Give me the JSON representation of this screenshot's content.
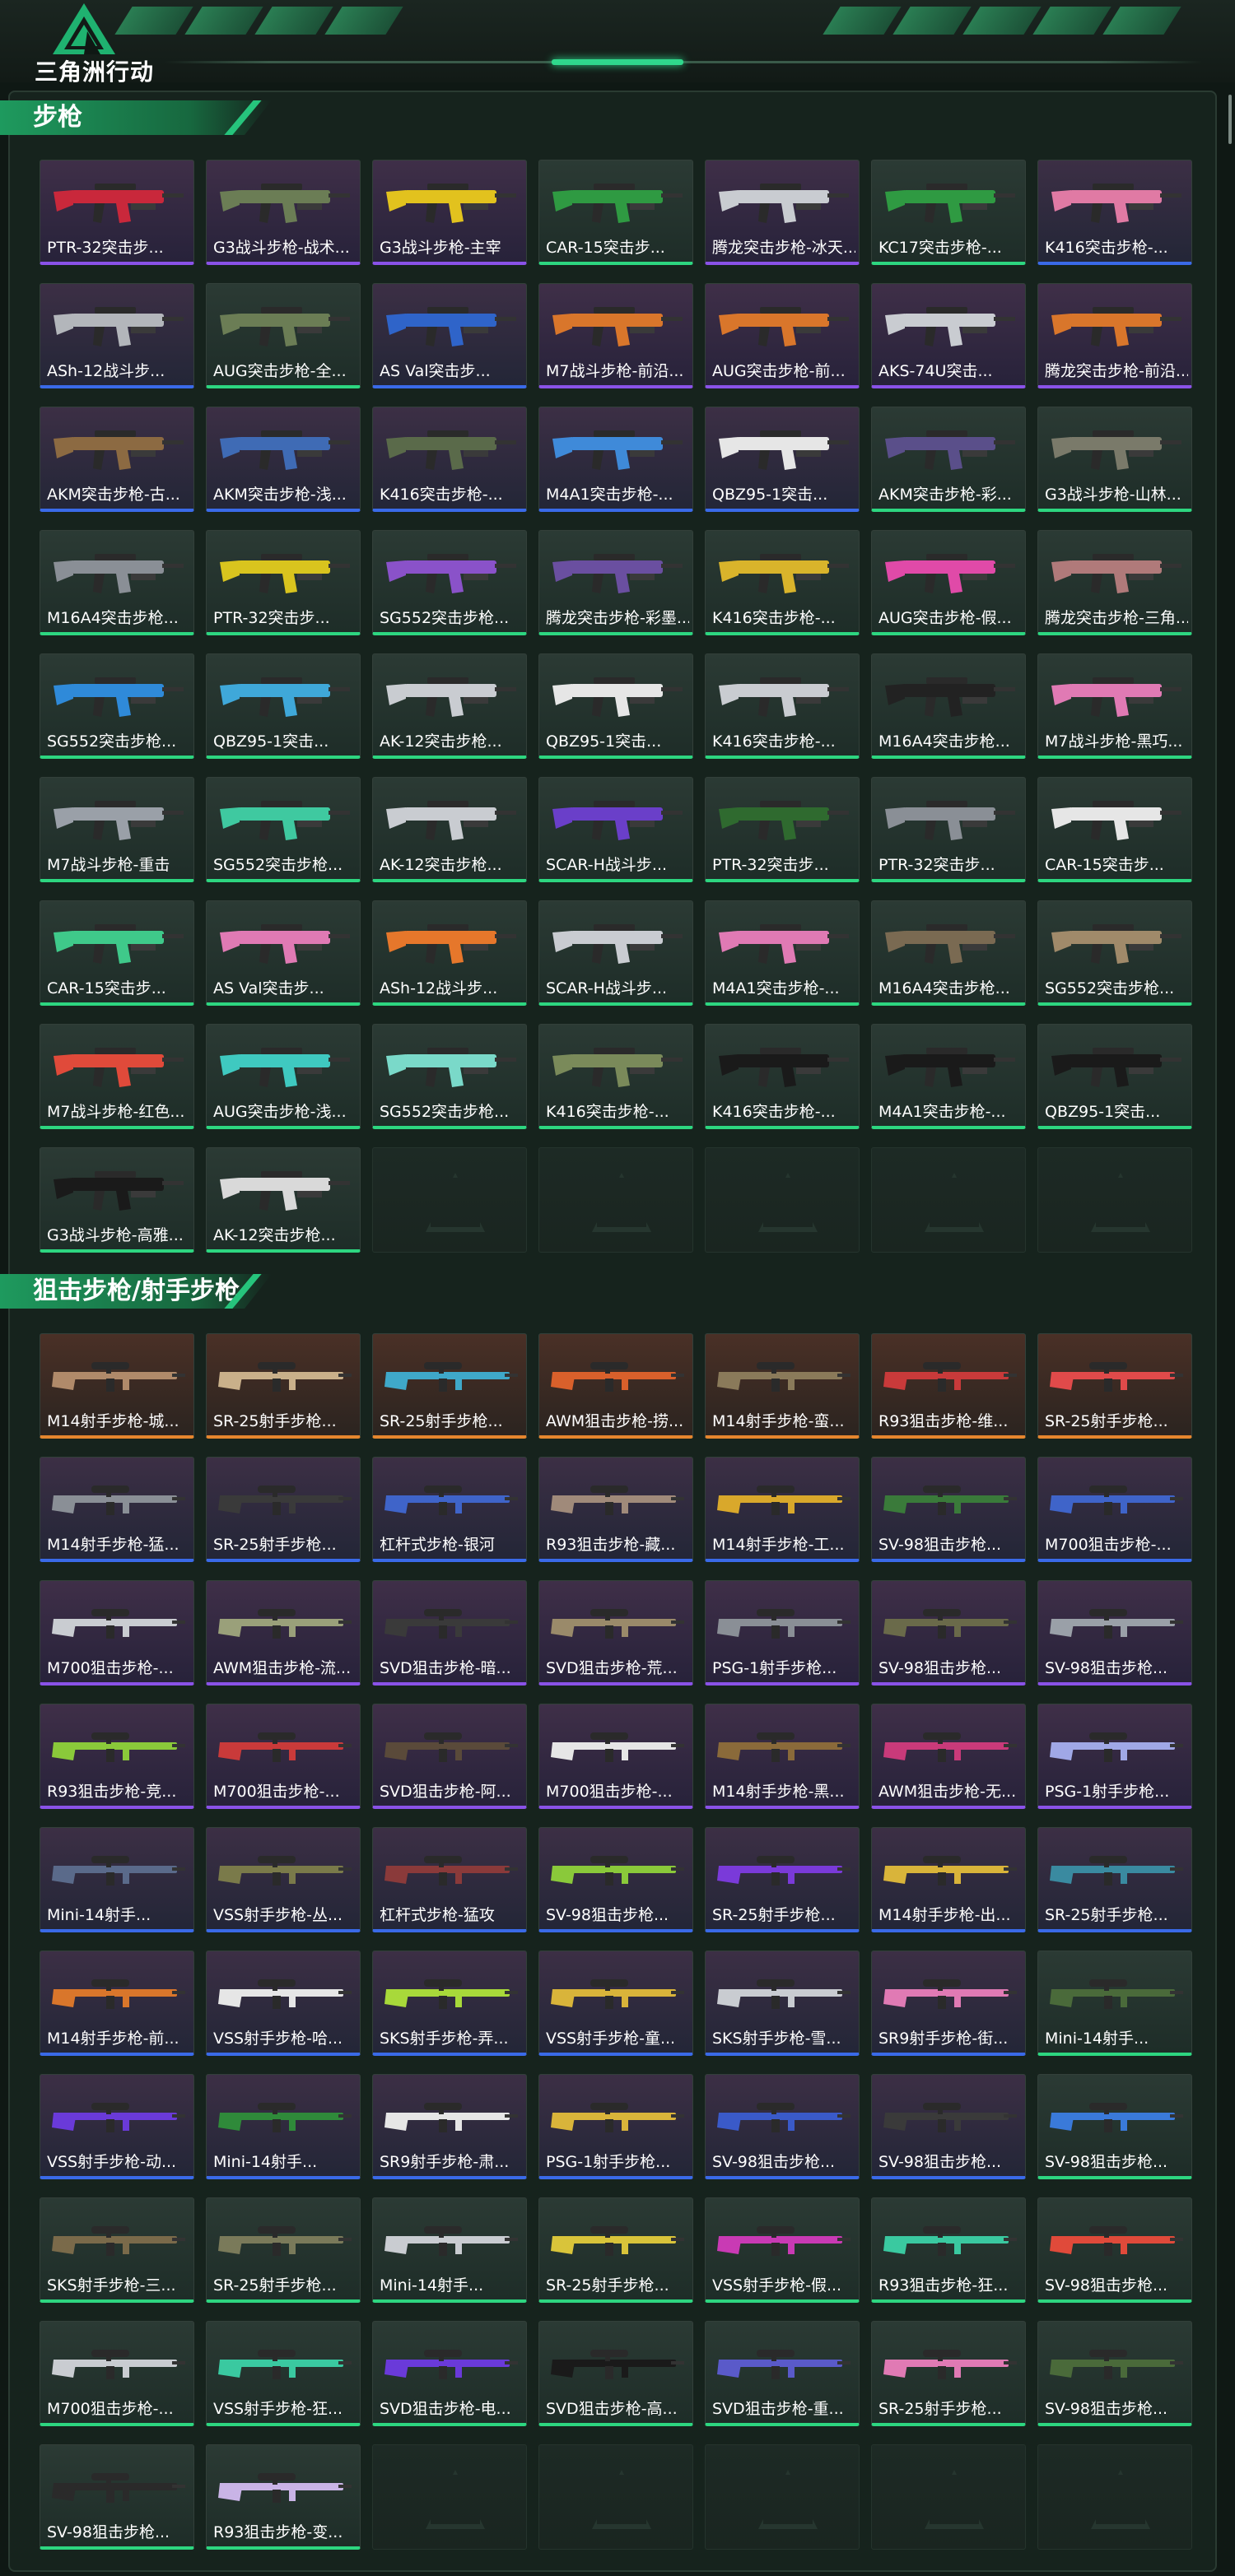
{
  "header": {
    "logo_text": "三角洲行动",
    "accent": "#2dd680"
  },
  "sections": [
    {
      "title": "步枪",
      "items": [
        {
          "label": "PTR-32突击步...",
          "rarity": "purple",
          "color": "#c9283b"
        },
        {
          "label": "G3战斗步枪-战术...",
          "rarity": "purple",
          "color": "#6b7d55"
        },
        {
          "label": "G3战斗步枪-主宰",
          "rarity": "purple",
          "color": "#e2c21e"
        },
        {
          "label": "CAR-15突击步...",
          "rarity": "green",
          "color": "#2f9a42"
        },
        {
          "label": "腾龙突击步枪-冰天...",
          "rarity": "purple",
          "color": "#c9ccd1"
        },
        {
          "label": "KC17突击步枪-...",
          "rarity": "green",
          "color": "#2f9a42"
        },
        {
          "label": "K416突击步枪-...",
          "rarity": "blue",
          "color": "#e07aa4"
        },
        {
          "label": "ASh-12战斗步...",
          "rarity": "blue",
          "color": "#b3b6bb"
        },
        {
          "label": "AUG突击步枪-全...",
          "rarity": "green",
          "color": "#6b7d55"
        },
        {
          "label": "AS Val突击步...",
          "rarity": "blue",
          "color": "#2f64c9"
        },
        {
          "label": "M7战斗步枪-前沿...",
          "rarity": "purple",
          "color": "#d9762b"
        },
        {
          "label": "AUG突击步枪-前...",
          "rarity": "purple",
          "color": "#d9762b"
        },
        {
          "label": "AKS-74U突击...",
          "rarity": "purple",
          "color": "#c9ccd1"
        },
        {
          "label": "腾龙突击步枪-前沿...",
          "rarity": "purple",
          "color": "#d9762b"
        },
        {
          "label": "AKM突击步枪-古...",
          "rarity": "blue",
          "color": "#8c6a42"
        },
        {
          "label": "AKM突击步枪-浅...",
          "rarity": "blue",
          "color": "#3f6bb5"
        },
        {
          "label": "K416突击步枪-...",
          "rarity": "blue",
          "color": "#5a6a4a"
        },
        {
          "label": "M4A1突击步枪-...",
          "rarity": "blue",
          "color": "#3f8ad9"
        },
        {
          "label": "QBZ95-1突击...",
          "rarity": "blue",
          "color": "#e6e6e6"
        },
        {
          "label": "AKM突击步枪-彩...",
          "rarity": "green",
          "color": "#5a4f8a"
        },
        {
          "label": "G3战斗步枪-山林...",
          "rarity": "green",
          "color": "#7a7a6a"
        },
        {
          "label": "M16A4突击步枪...",
          "rarity": "green",
          "color": "#8a8f96"
        },
        {
          "label": "PTR-32突击步...",
          "rarity": "green",
          "color": "#d9c41e"
        },
        {
          "label": "SG552突击步枪...",
          "rarity": "green",
          "color": "#8a52c9"
        },
        {
          "label": "腾龙突击步枪-彩墨...",
          "rarity": "green",
          "color": "#6a4fa0"
        },
        {
          "label": "K416突击步枪-...",
          "rarity": "green",
          "color": "#d9b42b"
        },
        {
          "label": "AUG突击步枪-假...",
          "rarity": "green",
          "color": "#e04aa8"
        },
        {
          "label": "腾龙突击步枪-三角...",
          "rarity": "green",
          "color": "#b07a7a"
        },
        {
          "label": "SG552突击步枪...",
          "rarity": "green",
          "color": "#2f8ad9"
        },
        {
          "label": "QBZ95-1突击...",
          "rarity": "green",
          "color": "#3fa8d9"
        },
        {
          "label": "AK-12突击步枪...",
          "rarity": "green",
          "color": "#c9ccd1"
        },
        {
          "label": "QBZ95-1突击...",
          "rarity": "green",
          "color": "#e6e6e6"
        },
        {
          "label": "K416突击步枪-...",
          "rarity": "green",
          "color": "#c9ccd1"
        },
        {
          "label": "M16A4突击步枪...",
          "rarity": "green",
          "color": "#222222"
        },
        {
          "label": "M7战斗步枪-黑巧...",
          "rarity": "green",
          "color": "#e07ab4"
        },
        {
          "label": "M7战斗步枪-重击",
          "rarity": "green",
          "color": "#9aa0a8"
        },
        {
          "label": "SG552突击步枪...",
          "rarity": "green",
          "color": "#3fc9a0"
        },
        {
          "label": "AK-12突击步枪...",
          "rarity": "green",
          "color": "#c9ccd1"
        },
        {
          "label": "SCAR-H战斗步...",
          "rarity": "green",
          "color": "#6a3fc9"
        },
        {
          "label": "PTR-32突击步...",
          "rarity": "green",
          "color": "#2f6a2f"
        },
        {
          "label": "PTR-32突击步...",
          "rarity": "green",
          "color": "#8a8f96"
        },
        {
          "label": "CAR-15突击步...",
          "rarity": "green",
          "color": "#e6e6e6"
        },
        {
          "label": "CAR-15突击步...",
          "rarity": "green",
          "color": "#3fc98a"
        },
        {
          "label": "AS Val突击步...",
          "rarity": "green",
          "color": "#e07ab4"
        },
        {
          "label": "ASh-12战斗步...",
          "rarity": "green",
          "color": "#e6772b"
        },
        {
          "label": "SCAR-H战斗步...",
          "rarity": "green",
          "color": "#c9ccd1"
        },
        {
          "label": "M4A1突击步枪-...",
          "rarity": "green",
          "color": "#e07ab4"
        },
        {
          "label": "M16A4突击步枪...",
          "rarity": "green",
          "color": "#7a6a52"
        },
        {
          "label": "SG552突击步枪...",
          "rarity": "green",
          "color": "#a08a6a"
        },
        {
          "label": "M7战斗步枪-红色...",
          "rarity": "green",
          "color": "#e04a3a"
        },
        {
          "label": "AUG突击步枪-浅...",
          "rarity": "green",
          "color": "#3fc9c0"
        },
        {
          "label": "SG552突击步枪...",
          "rarity": "green",
          "color": "#7ad9c9"
        },
        {
          "label": "K416突击步枪-...",
          "rarity": "green",
          "color": "#7a8a5a"
        },
        {
          "label": "K416突击步枪-...",
          "rarity": "green",
          "color": "#1a1a1a"
        },
        {
          "label": "M4A1突击步枪-...",
          "rarity": "green",
          "color": "#1a1a1a"
        },
        {
          "label": "QBZ95-1突击...",
          "rarity": "green",
          "color": "#1a1a1a"
        },
        {
          "label": "G3战斗步枪-高雅...",
          "rarity": "green",
          "color": "#1a1a1a"
        },
        {
          "label": "AK-12突击步枪...",
          "rarity": "green",
          "color": "#d9d9d9"
        },
        {
          "label": "",
          "rarity": "empty",
          "color": ""
        },
        {
          "label": "",
          "rarity": "empty",
          "color": ""
        },
        {
          "label": "",
          "rarity": "empty",
          "color": ""
        },
        {
          "label": "",
          "rarity": "empty",
          "color": ""
        },
        {
          "label": "",
          "rarity": "empty",
          "color": ""
        }
      ]
    },
    {
      "title": "狙击步枪/射手步枪",
      "items": [
        {
          "label": "M14射手步枪-城...",
          "rarity": "orange",
          "color": "#b08a6a"
        },
        {
          "label": "SR-25射手步枪...",
          "rarity": "orange",
          "color": "#c9b08a"
        },
        {
          "label": "SR-25射手步枪...",
          "rarity": "orange",
          "color": "#3fa8c9"
        },
        {
          "label": "AWM狙击步枪-捞...",
          "rarity": "orange",
          "color": "#d9602b"
        },
        {
          "label": "M14射手步枪-蛮...",
          "rarity": "orange",
          "color": "#8a7a5a"
        },
        {
          "label": "R93狙击步枪-维...",
          "rarity": "orange",
          "color": "#c93a3a"
        },
        {
          "label": "SR-25射手步枪...",
          "rarity": "orange",
          "color": "#e04a4a"
        },
        {
          "label": "M14射手步枪-猛...",
          "rarity": "blue",
          "color": "#8a8f96"
        },
        {
          "label": "SR-25射手步枪...",
          "rarity": "blue",
          "color": "#3a3a3a"
        },
        {
          "label": "杠杆式步枪-银河",
          "rarity": "blue",
          "color": "#3f64c9"
        },
        {
          "label": "R93狙击步枪-藏...",
          "rarity": "blue",
          "color": "#a08a7a"
        },
        {
          "label": "M14射手步枪-工...",
          "rarity": "blue",
          "color": "#d9a82b"
        },
        {
          "label": "SV-98狙击步枪...",
          "rarity": "blue",
          "color": "#3a7a3a"
        },
        {
          "label": "M700狙击步枪-...",
          "rarity": "blue",
          "color": "#3f64c9"
        },
        {
          "label": "M700狙击步枪-...",
          "rarity": "purple",
          "color": "#c9ccd1"
        },
        {
          "label": "AWM狙击步枪-流...",
          "rarity": "purple",
          "color": "#9aa07a"
        },
        {
          "label": "SVD狙击步枪-暗...",
          "rarity": "purple",
          "color": "#3a3a3a"
        },
        {
          "label": "SVD狙击步枪-荒...",
          "rarity": "purple",
          "color": "#9a8a6a"
        },
        {
          "label": "PSG-1射手步枪...",
          "rarity": "purple",
          "color": "#8a8f96"
        },
        {
          "label": "SV-98狙击步枪...",
          "rarity": "purple",
          "color": "#6a6a4a"
        },
        {
          "label": "SV-98狙击步枪...",
          "rarity": "purple",
          "color": "#9aa0a8"
        },
        {
          "label": "R93狙击步枪-竞...",
          "rarity": "purple",
          "color": "#8ac93a"
        },
        {
          "label": "M700狙击步枪-...",
          "rarity": "purple",
          "color": "#c93a3a"
        },
        {
          "label": "SVD狙击步枪-阿...",
          "rarity": "purple",
          "color": "#5a4a3a"
        },
        {
          "label": "M700狙击步枪-...",
          "rarity": "purple",
          "color": "#e6e6e6"
        },
        {
          "label": "M14射手步枪-黑...",
          "rarity": "purple",
          "color": "#8a6a3a"
        },
        {
          "label": "AWM狙击步枪-无...",
          "rarity": "purple",
          "color": "#c93a7a"
        },
        {
          "label": "PSG-1射手步枪...",
          "rarity": "purple",
          "color": "#a0a8e6"
        },
        {
          "label": "Mini-14射手...",
          "rarity": "blue",
          "color": "#5a6a8a"
        },
        {
          "label": "VSS射手步枪-丛...",
          "rarity": "blue",
          "color": "#7a7a4a"
        },
        {
          "label": "杠杆式步枪-猛攻",
          "rarity": "blue",
          "color": "#8a3a3a"
        },
        {
          "label": "SV-98狙击步枪...",
          "rarity": "blue",
          "color": "#8ac93a"
        },
        {
          "label": "SR-25射手步枪...",
          "rarity": "blue",
          "color": "#7a3ad9"
        },
        {
          "label": "M14射手步枪-出...",
          "rarity": "blue",
          "color": "#d9b43a"
        },
        {
          "label": "SR-25射手步枪...",
          "rarity": "blue",
          "color": "#3a8aa0"
        },
        {
          "label": "M14射手步枪-前...",
          "rarity": "blue",
          "color": "#d9762b"
        },
        {
          "label": "VSS射手步枪-哈...",
          "rarity": "blue",
          "color": "#e6e6e6"
        },
        {
          "label": "SKS射手步枪-弄...",
          "rarity": "blue",
          "color": "#a8d93a"
        },
        {
          "label": "VSS射手步枪-童...",
          "rarity": "blue",
          "color": "#d9b43a"
        },
        {
          "label": "SKS射手步枪-雪...",
          "rarity": "blue",
          "color": "#c9ccd1"
        },
        {
          "label": "SR9射手步枪-街...",
          "rarity": "blue",
          "color": "#e07ab4"
        },
        {
          "label": "Mini-14射手...",
          "rarity": "green",
          "color": "#4a6a3a"
        },
        {
          "label": "VSS射手步枪-动...",
          "rarity": "blue",
          "color": "#6a3ad9"
        },
        {
          "label": "Mini-14射手...",
          "rarity": "blue",
          "color": "#2f8a3a"
        },
        {
          "label": "SR9射手步枪-肃...",
          "rarity": "blue",
          "color": "#e6e6e6"
        },
        {
          "label": "PSG-1射手步枪...",
          "rarity": "blue",
          "color": "#d9b43a"
        },
        {
          "label": "SV-98狙击步枪...",
          "rarity": "blue",
          "color": "#3a5ac9"
        },
        {
          "label": "SV-98狙击步枪...",
          "rarity": "blue",
          "color": "#3a3a3a"
        },
        {
          "label": "SV-98狙击步枪...",
          "rarity": "green",
          "color": "#3a7ad9"
        },
        {
          "label": "SKS射手步枪-三...",
          "rarity": "green",
          "color": "#7a6a4a"
        },
        {
          "label": "SR-25射手步枪...",
          "rarity": "green",
          "color": "#7a7a5a"
        },
        {
          "label": "Mini-14射手...",
          "rarity": "green",
          "color": "#c9ccd1"
        },
        {
          "label": "SR-25射手步枪...",
          "rarity": "green",
          "color": "#d9c43a"
        },
        {
          "label": "VSS射手步枪-假...",
          "rarity": "green",
          "color": "#c93ab4"
        },
        {
          "label": "R93狙击步枪-狂...",
          "rarity": "green",
          "color": "#3ac9a0"
        },
        {
          "label": "SV-98狙击步枪...",
          "rarity": "green",
          "color": "#e04a3a"
        },
        {
          "label": "M700狙击步枪-...",
          "rarity": "green",
          "color": "#c9ccd1"
        },
        {
          "label": "VSS射手步枪-狂...",
          "rarity": "green",
          "color": "#3ac9a0"
        },
        {
          "label": "SVD狙击步枪-电...",
          "rarity": "green",
          "color": "#6a3ad9"
        },
        {
          "label": "SVD狙击步枪-高...",
          "rarity": "green",
          "color": "#1a1a1a"
        },
        {
          "label": "SVD狙击步枪-重...",
          "rarity": "green",
          "color": "#5a5ac9"
        },
        {
          "label": "SR-25射手步枪...",
          "rarity": "green",
          "color": "#e07ab4"
        },
        {
          "label": "SV-98狙击步枪...",
          "rarity": "green",
          "color": "#4a6a3a"
        },
        {
          "label": "SV-98狙击步枪...",
          "rarity": "green",
          "color": "#2a2a2a"
        },
        {
          "label": "R93狙击步枪-变...",
          "rarity": "green",
          "color": "#c9b4e6"
        },
        {
          "label": "",
          "rarity": "empty",
          "color": ""
        },
        {
          "label": "",
          "rarity": "empty",
          "color": ""
        },
        {
          "label": "",
          "rarity": "empty",
          "color": ""
        },
        {
          "label": "",
          "rarity": "empty",
          "color": ""
        },
        {
          "label": "",
          "rarity": "empty",
          "color": ""
        }
      ]
    }
  ]
}
